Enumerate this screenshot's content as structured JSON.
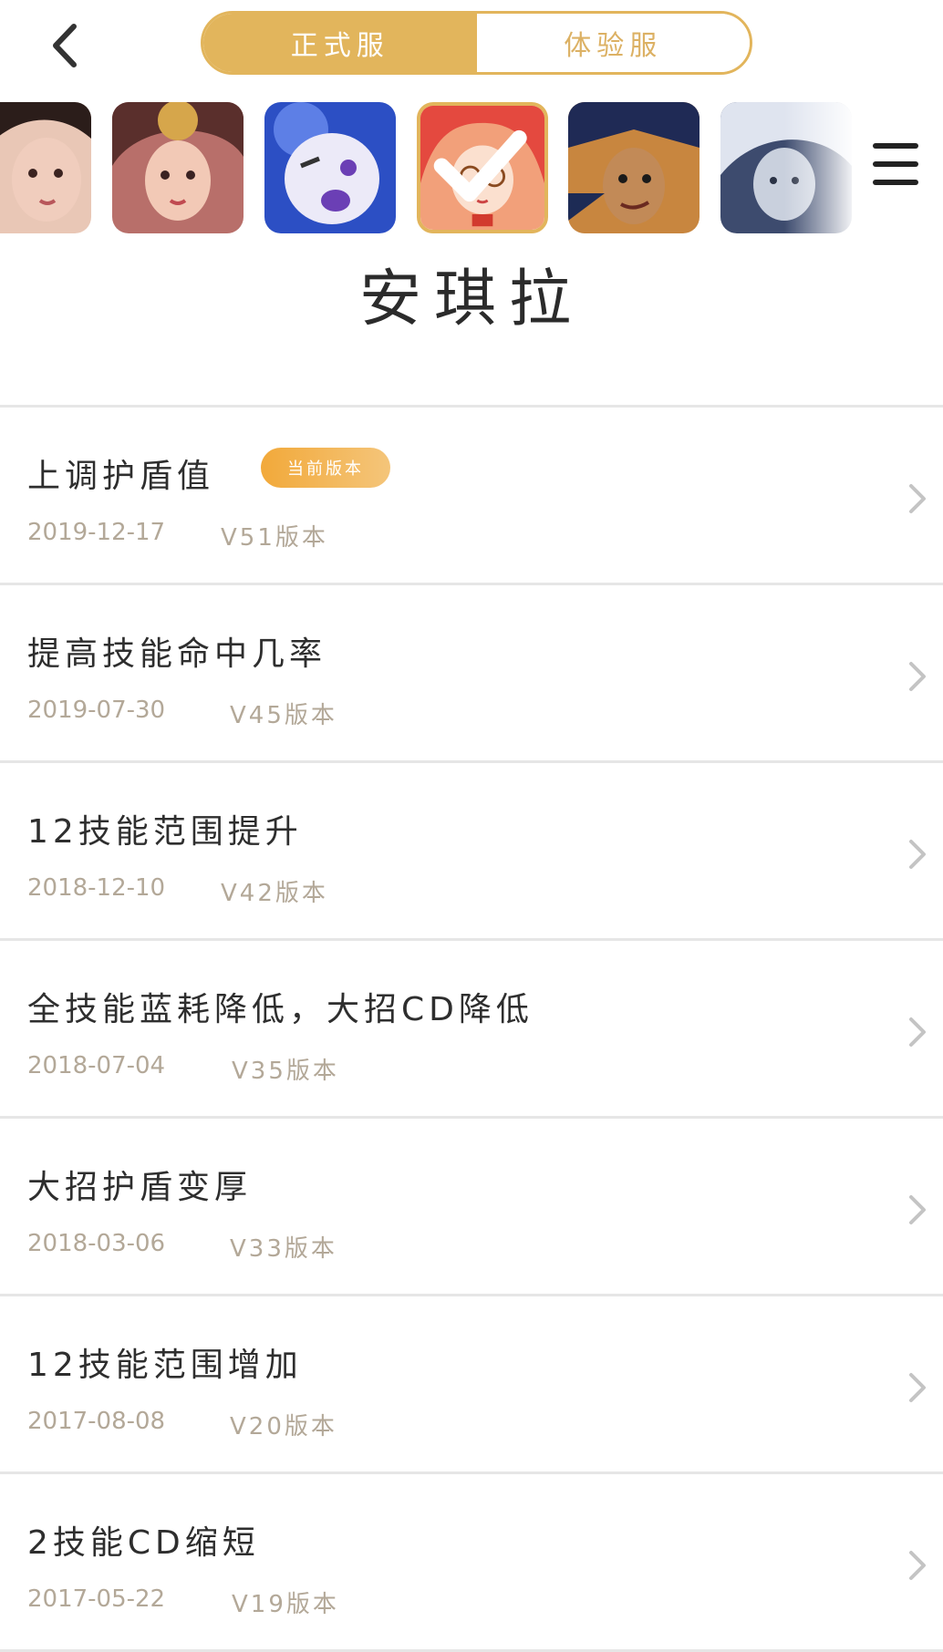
{
  "header": {
    "tabs": [
      {
        "label": "正式服",
        "active": true
      },
      {
        "label": "体验服",
        "active": false
      }
    ],
    "back_icon": "chevron-left-icon",
    "menu_icon": "hamburger-menu-icon"
  },
  "carousel": {
    "selected_index": 3,
    "heroes": [
      {
        "name": "hero-portrait-1",
        "palette": [
          "#d9b6a6",
          "#2b1d1a"
        ]
      },
      {
        "name": "hero-portrait-2",
        "palette": [
          "#c97c7c",
          "#4a2b2b"
        ]
      },
      {
        "name": "hero-portrait-3",
        "palette": [
          "#3e63c9",
          "#e8e6f7"
        ]
      },
      {
        "name": "hero-portrait-4",
        "palette": [
          "#e4493f",
          "#f4c25a"
        ]
      },
      {
        "name": "hero-portrait-5",
        "palette": [
          "#1d2b55",
          "#c28a57"
        ]
      },
      {
        "name": "hero-portrait-6",
        "palette": [
          "#5c6b8c",
          "#dfe4ef"
        ]
      }
    ]
  },
  "hero": {
    "name": "安琪拉"
  },
  "badge_label": "当前版本",
  "changes": [
    {
      "title": "上调护盾值",
      "date": "2019-12-17",
      "version": "V51版本",
      "current": true
    },
    {
      "title": "提高技能命中几率",
      "date": "2019-07-30",
      "version": "V45版本",
      "current": false
    },
    {
      "title": "12技能范围提升",
      "date": "2018-12-10",
      "version": "V42版本",
      "current": false
    },
    {
      "title": "全技能蓝耗降低，大招CD降低",
      "date": "2018-07-04",
      "version": "V35版本",
      "current": false
    },
    {
      "title": "大招护盾变厚",
      "date": "2018-03-06",
      "version": "V33版本",
      "current": false
    },
    {
      "title": "12技能范围增加",
      "date": "2017-08-08",
      "version": "V20版本",
      "current": false
    },
    {
      "title": "2技能CD缩短",
      "date": "2017-05-22",
      "version": "V19版本",
      "current": false
    }
  ],
  "colors": {
    "accent": "#e2b55c",
    "badge": "#f2a93a",
    "meta_text": "#b3a898",
    "divider": "#e6e6e6"
  }
}
